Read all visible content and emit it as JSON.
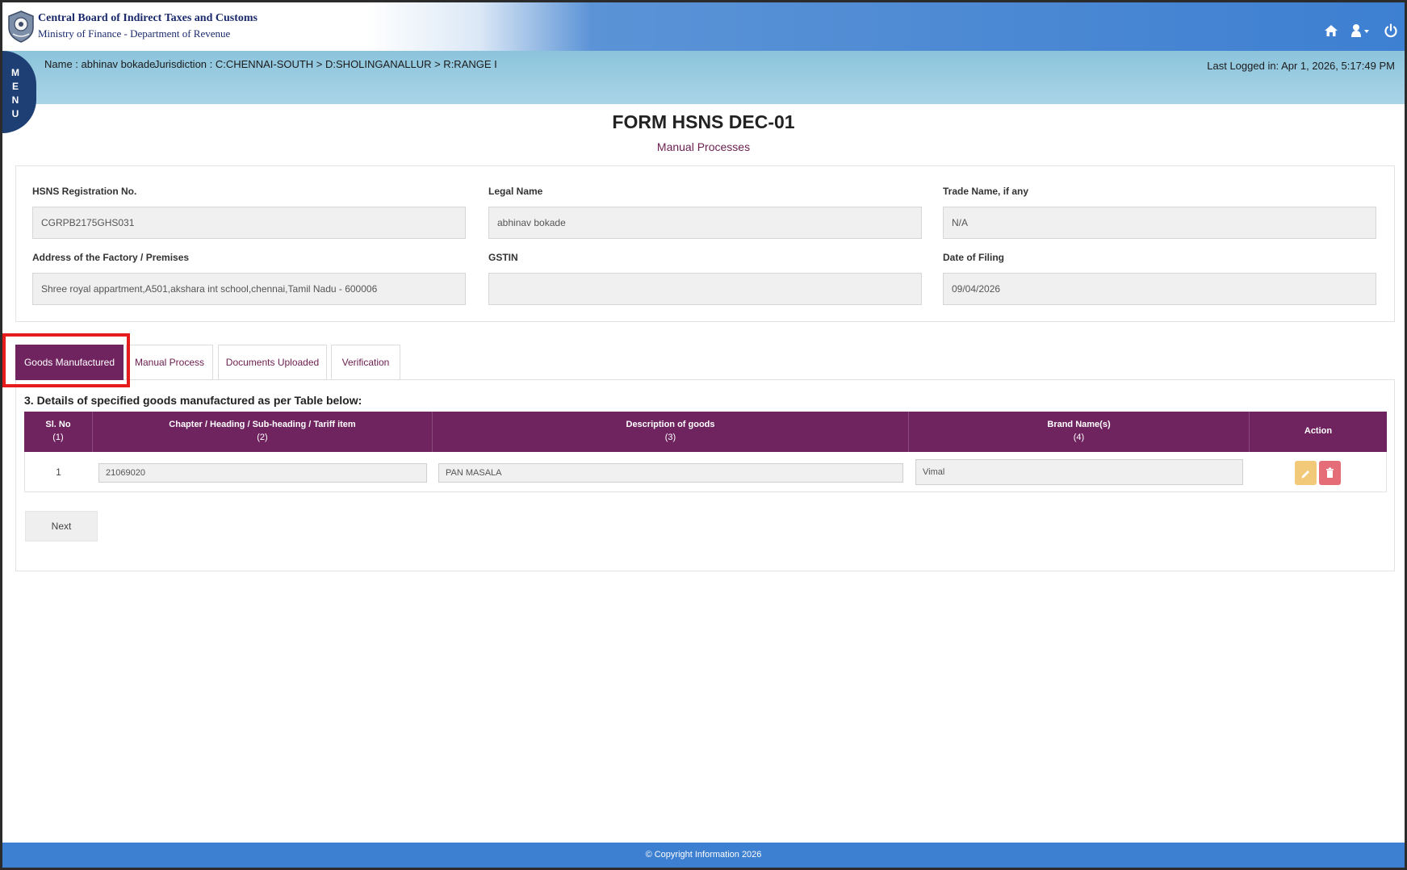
{
  "header": {
    "org_name": "Central Board of Indirect Taxes and Customs",
    "org_sub": "Ministry of Finance - Department of Revenue"
  },
  "infobar": {
    "name": "Name : abhinav bokade",
    "jurisdiction": "Jurisdiction : C:CHENNAI-SOUTH > D:SHOLINGANALLUR > R:RANGE I",
    "last_logged": "Last Logged in: Apr 1, 2026, 5:17:49 PM"
  },
  "menu": {
    "letters": [
      "M",
      "E",
      "N",
      "U"
    ]
  },
  "form": {
    "title": "FORM HSNS DEC-01",
    "subtitle": "Manual Processes"
  },
  "fields": {
    "reg_no": {
      "label": "HSNS Registration No.",
      "value": "CGRPB2175GHS031"
    },
    "legal_name": {
      "label": "Legal Name",
      "value": "abhinav bokade"
    },
    "trade_name": {
      "label": "Trade Name, if any",
      "value": "N/A"
    },
    "address": {
      "label": "Address of the Factory / Premises",
      "value": "Shree royal appartment,A501,akshara int school,chennai,Tamil Nadu - 600006"
    },
    "gstin": {
      "label": "GSTIN",
      "value": ""
    },
    "date_filing": {
      "label": "Date of Filing",
      "value": "09/04/2026"
    }
  },
  "tabs": [
    {
      "label": "Goods Manufactured"
    },
    {
      "label": "Manual Process"
    },
    {
      "label": "Documents Uploaded"
    },
    {
      "label": "Verification"
    }
  ],
  "section": {
    "heading": "3. Details of specified goods manufactured as per Table below:"
  },
  "table": {
    "columns": [
      {
        "title": "Sl. No",
        "num": "(1)"
      },
      {
        "title": "Chapter / Heading / Sub-heading / Tariff item",
        "num": "(2)"
      },
      {
        "title": "Description of goods",
        "num": "(3)"
      },
      {
        "title": "Brand Name(s)",
        "num": "(4)"
      },
      {
        "title": "Action",
        "num": ""
      }
    ],
    "rows": [
      {
        "sl": "1",
        "chapter": "21069020",
        "description": "PAN MASALA",
        "brand": "Vimal"
      }
    ]
  },
  "buttons": {
    "next": "Next"
  },
  "footer": {
    "text": "© Copyright Information 2026"
  },
  "colors": {
    "header_blue": "#3d7fd1",
    "purple": "#6f2460",
    "highlight_red": "#e61b1b",
    "edit_yellow": "#f2c879",
    "delete_red": "#e56d78"
  }
}
